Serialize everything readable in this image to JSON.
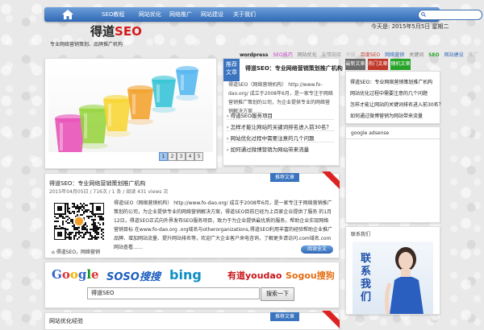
{
  "nav": {
    "items": [
      "SEO教程",
      "网站优化",
      "网络推广",
      "网站建设",
      "关于我们"
    ]
  },
  "header": {
    "logo_main": "得道",
    "logo_seo": "SEO",
    "slogan": "专业网络营销策划、品牌推广机构",
    "date": "今天是: 2015年5月5日 星期二"
  },
  "tags": [
    {
      "label": "wordpress",
      "color": "#222222"
    },
    {
      "label": "SEO技巧",
      "color": "#c33ac3"
    },
    {
      "label": "网站优化",
      "color": "#7a7a7a"
    },
    {
      "label": "友情链接",
      "color": "#9a9a9a"
    },
    {
      "label": "外链",
      "color": "#b7b7b7"
    },
    {
      "label": "百度SEO",
      "color": "#c0392b"
    },
    {
      "label": "网络营销",
      "color": "#2f68b5"
    },
    {
      "label": "关键词",
      "color": "#7a7a7a"
    },
    {
      "label": "SEO",
      "color": "#27a327"
    },
    {
      "label": "网站建设",
      "color": "#2f68b5"
    },
    {
      "label": "推广",
      "color": "#b7b7b7"
    }
  ],
  "slider": {
    "pages": [
      "1",
      "2",
      "3",
      "4",
      "5"
    ],
    "active": 1,
    "cups": [
      "#e74fb7",
      "#96d43d",
      "#f7d531",
      "#f2a02b",
      "#33c3d6",
      "#53b6ef"
    ]
  },
  "featured": {
    "badge": "推荐文章",
    "title": "得道SEO：专业网络营销策划推广机构",
    "text": "得道SEO（网络营销机构） http://www.fo-dao.org/ 成立于2008年6月，是一家专注于网络营销推广策划的公司，为企业提供专业的网络营销解决方案……",
    "links": [
      "得道SEO服务项目",
      "怎样才能让网站的关键词排名进入前30名？",
      "网站优化过程中需要注意的几个问题",
      "如何通过微博营销为网站带来流量"
    ]
  },
  "tabs": {
    "labels": [
      "最新文章",
      "热门文章",
      "随机文章"
    ],
    "colors": [
      "#6b6b6b",
      "#c0392b",
      "#27a327"
    ],
    "items": [
      "得道SEO：专业网络营销策划推广机构",
      "网站优化过程中需要注意的几个问题",
      "怎样才能让网站的关键词排名进入前30名？",
      "如何通过微博营销为网站带来流量"
    ]
  },
  "adsense": {
    "title": "google adsense"
  },
  "contact": {
    "title": "联系我们",
    "text": "联系我们"
  },
  "post": {
    "title": "得道SEO：专业网络营销策划推广机构",
    "meta": "2015年04月05日 / 716次 / 1 条 / 阅读 431 views 次",
    "badge": "推荐文章",
    "text": "得道SEO（网络营销机构） http://www.fo-dao.org/ 成立于2008年6月，是一家专注于网络营销推广策划的公司，为企业提供专业的网络营销解决方案，得道SEO目前已经为上百家企业提供了服务 的1月12日，得道SEO正式向外界发布SEO服务项目，致力于为企业提供最优质的服务，帮助企业实现网络营销目标 在www.fo-dao.org .org域名与otherorganizations,得道SEO利用丰富的经验帮助企业推广品牌、增加网站流量、提升网站排名等，欢迎广大企业客户来电咨询，了解更多请访问.com域名.com网站查看……",
    "more": "阅读全文",
    "tags": "得道SEO，网络营销"
  },
  "engines": {
    "logos": [
      "Google",
      "SOSO搜搜",
      "bing",
      "有道youdao",
      "Sogou搜狗"
    ],
    "query": "得道SEO",
    "button": "搜索一下"
  },
  "bottom": {
    "title": "网站优化经验",
    "badge": "推荐文章"
  }
}
